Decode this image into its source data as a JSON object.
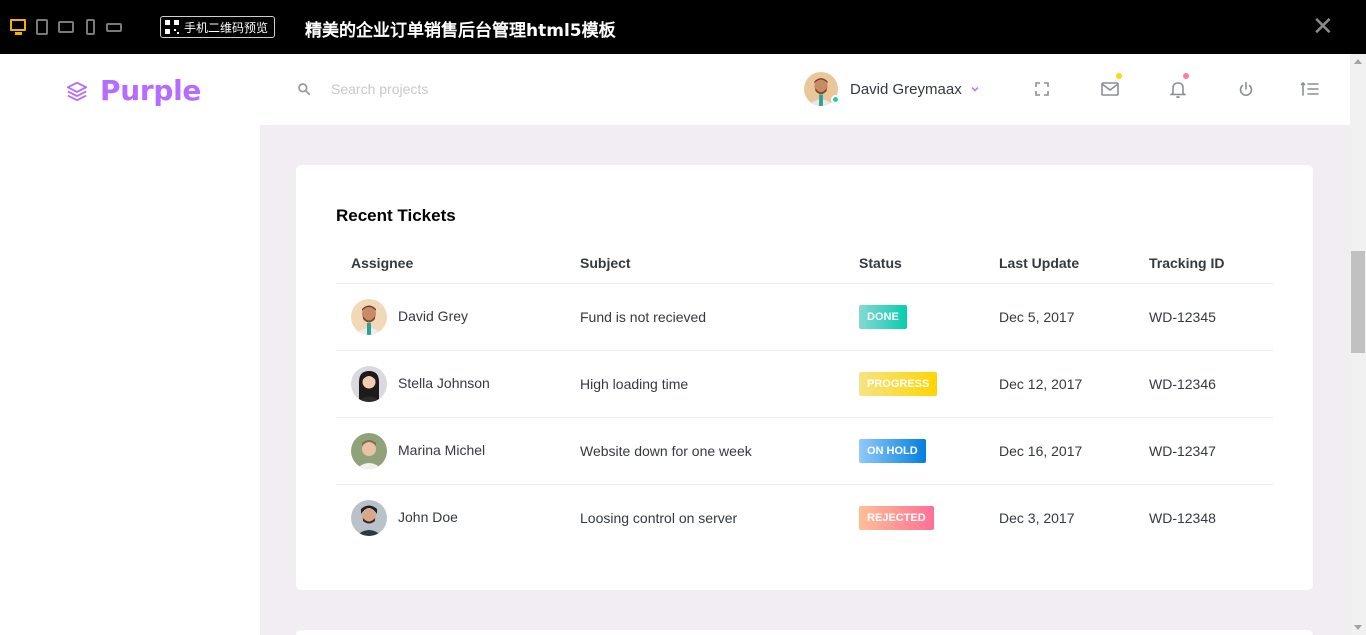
{
  "preview_bar": {
    "qr_label": "手机二维码预览",
    "title": "精美的企业订单销售后台管理html5模板",
    "close_glyph": "✕",
    "accent": "#f0b400"
  },
  "navbar": {
    "brand": "Purple",
    "brand_color": "#b66dff",
    "search": {
      "placeholder": "Search projects",
      "value": ""
    },
    "profile": {
      "name": "David Greymaax",
      "caret": "⌄"
    },
    "icons": [
      "fullscreen-icon",
      "mail-icon",
      "bell-icon",
      "power-icon",
      "list-icon"
    ],
    "mail_dot_color": "#fed713",
    "bell_dot_color": "#fe7c96"
  },
  "recent_tickets": {
    "title": "Recent Tickets",
    "columns": [
      "Assignee",
      "Subject",
      "Status",
      "Last Update",
      "Tracking ID"
    ],
    "rows": [
      {
        "assignee": "David Grey",
        "subject": "Fund is not recieved",
        "status": "DONE",
        "last_update": "Dec 5, 2017",
        "tracking_id": "WD-12345"
      },
      {
        "assignee": "Stella Johnson",
        "subject": "High loading time",
        "status": "PROGRESS",
        "last_update": "Dec 12, 2017",
        "tracking_id": "WD-12346"
      },
      {
        "assignee": "Marina Michel",
        "subject": "Website down for one week",
        "status": "ON HOLD",
        "last_update": "Dec 16, 2017",
        "tracking_id": "WD-12347"
      },
      {
        "assignee": "John Doe",
        "subject": "Loosing control on server",
        "status": "REJECTED",
        "last_update": "Dec 3, 2017",
        "tracking_id": "WD-12348"
      }
    ],
    "status_colors": {
      "done": "#1bcfb4",
      "progress": "#fed713",
      "on_hold": "#198ae3",
      "rejected": "#fe7096"
    }
  }
}
